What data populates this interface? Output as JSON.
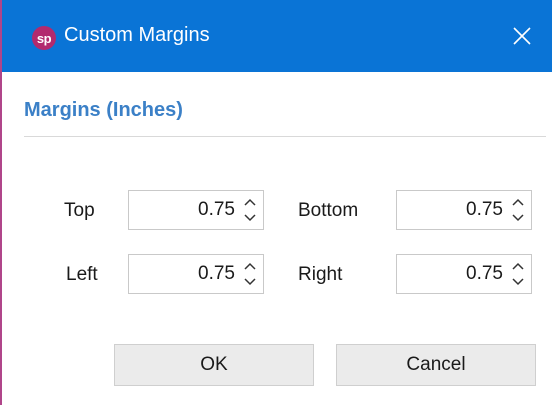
{
  "window": {
    "title": "Custom Margins",
    "app_logo_text": "sp"
  },
  "section": {
    "title": "Margins (Inches)"
  },
  "fields": {
    "top": {
      "label": "Top",
      "value": "0.75"
    },
    "bottom": {
      "label": "Bottom",
      "value": "0.75"
    },
    "left": {
      "label": "Left",
      "value": "0.75"
    },
    "right": {
      "label": "Right",
      "value": "0.75"
    }
  },
  "buttons": {
    "ok_label": "OK",
    "cancel_label": "Cancel"
  },
  "colors": {
    "titlebar": "#0a74d6",
    "section_title": "#3b80c7",
    "logo": "#b22a6e",
    "window_border": "#b0458a"
  },
  "icons": {
    "close": "close-icon",
    "spin_up": "chevron-up-icon",
    "spin_down": "chevron-down-icon"
  }
}
